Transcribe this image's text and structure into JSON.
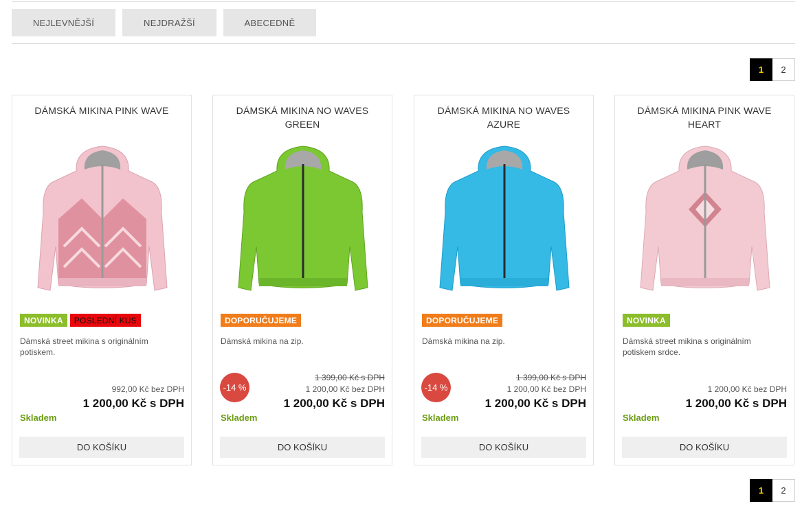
{
  "sort": {
    "buttons": [
      {
        "label": "NEJLEVNĚJŠÍ"
      },
      {
        "label": "NEJDRAŽŠÍ"
      },
      {
        "label": "ABECEDNĚ"
      }
    ]
  },
  "pagination": {
    "pages": [
      "1",
      "2"
    ],
    "active": "1"
  },
  "colors": {
    "label_new": "#8cbd2a",
    "label_last": "#e8070c",
    "label_recommended": "#f07c1a",
    "discount_badge": "#d9493f",
    "stock_text": "#6c9b13",
    "active_page_bg": "#000000",
    "active_page_text": "#ffd400"
  },
  "products": [
    {
      "title": "DÁMSKÁ MIKINA PINK WAVE",
      "image": "pink-hoodie-wave-pattern",
      "labels": [
        {
          "text": "NOVINKA",
          "color": "#8cbd2a"
        },
        {
          "text": "POSLEDNÍ KUS",
          "color": "#e8070c"
        }
      ],
      "description": "Dámská street mikina s originálním potiskem.",
      "discount": "",
      "price_old": "",
      "price_novat": "992,00 Kč bez DPH",
      "price_vat": "1 200,00 Kč s DPH",
      "stock": "Skladem",
      "cart_label": "DO KOŠÍKU"
    },
    {
      "title": "DÁMSKÁ MIKINA NO WAVES GREEN",
      "image": "green-zip-hoodie",
      "labels": [
        {
          "text": "DOPORUČUJEME",
          "color": "#f07c1a"
        }
      ],
      "description": "Dámská mikina na zip.",
      "discount": "-14 %",
      "price_old": "1 399,00 Kč s DPH",
      "price_novat": "1 200,00 Kč bez DPH",
      "price_vat": "1 200,00 Kč s DPH",
      "stock": "Skladem",
      "cart_label": "DO KOŠÍKU"
    },
    {
      "title": "DÁMSKÁ MIKINA NO WAVES AZURE",
      "image": "azure-zip-hoodie",
      "labels": [
        {
          "text": "DOPORUČUJEME",
          "color": "#f07c1a"
        }
      ],
      "description": "Dámská mikina na zip.",
      "discount": "-14 %",
      "price_old": "1 399,00 Kč s DPH",
      "price_novat": "1 200,00 Kč bez DPH",
      "price_vat": "1 200,00 Kč s DPH",
      "stock": "Skladem",
      "cart_label": "DO KOŠÍKU"
    },
    {
      "title": "DÁMSKÁ MIKINA PINK WAVE HEART",
      "image": "pink-hoodie-heart-print",
      "labels": [
        {
          "text": "NOVINKA",
          "color": "#8cbd2a"
        }
      ],
      "description": "Dámská street mikina s originálním potiskem srdce.",
      "discount": "",
      "price_old": "",
      "price_novat": "1 200,00 Kč bez DPH",
      "price_vat": "1 200,00 Kč s DPH",
      "stock": "Skladem",
      "cart_label": "DO KOŠÍKU"
    }
  ]
}
